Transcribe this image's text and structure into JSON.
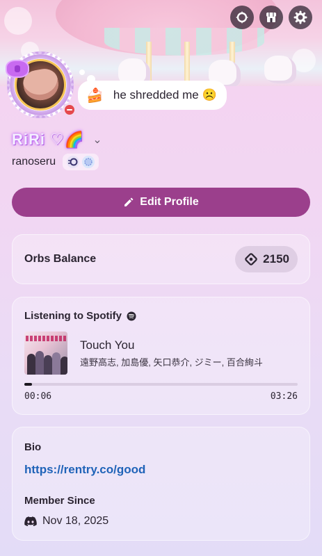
{
  "header": {
    "icons": [
      "nitro-icon",
      "shop-icon",
      "settings-icon"
    ]
  },
  "status": {
    "emoji": "🍰",
    "text": "he shredded me ☹️"
  },
  "profile": {
    "display_name": "RiRi ♡🌈",
    "username": "ranoseru",
    "online_status": "do-not-disturb"
  },
  "edit_profile": {
    "label": "Edit Profile"
  },
  "orbs": {
    "label": "Orbs Balance",
    "value": "2150"
  },
  "spotify": {
    "header": "Listening to Spotify",
    "song": "Touch You",
    "artists": "遠野高志, 加島優, 矢口恭介, ジミー, 百合絢斗",
    "elapsed": "00:06",
    "duration": "03:26",
    "progress_fraction": 0.029
  },
  "bio": {
    "label": "Bio",
    "link": "https://rentry.co/good"
  },
  "member_since": {
    "label": "Member Since",
    "date": "Nov 18, 2025"
  },
  "colors": {
    "accent": "#9b3f8c",
    "link": "#1f63b8",
    "dnd": "#e5484d"
  }
}
